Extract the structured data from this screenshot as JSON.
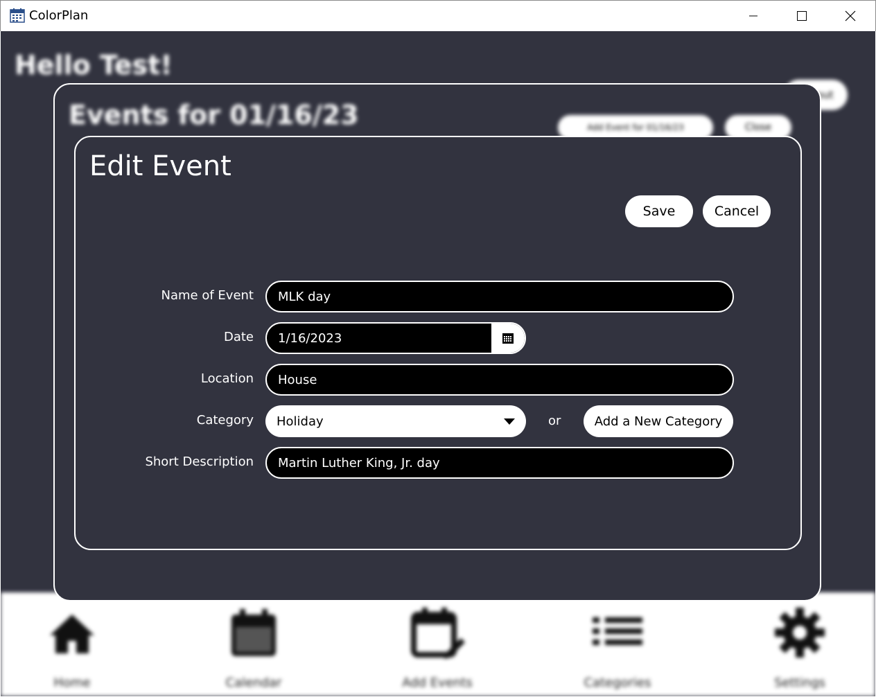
{
  "window": {
    "title": "ColorPlan",
    "icon": "calendar-app-icon"
  },
  "background": {
    "greeting": "Hello Test!",
    "top_right_button": "Logout",
    "nav": [
      {
        "label": "Home",
        "icon": "home-icon"
      },
      {
        "label": "Calendar",
        "icon": "calendar-icon"
      },
      {
        "label": "Add Events",
        "icon": "calendar-edit-icon"
      },
      {
        "label": "Categories",
        "icon": "list-icon"
      },
      {
        "label": "Settings",
        "icon": "gear-icon"
      }
    ]
  },
  "events_dialog": {
    "title": "Events for 01/16/23",
    "add_button": "Add Event for 01/16/23",
    "close_button": "Close"
  },
  "edit_dialog": {
    "title": "Edit Event",
    "save_label": "Save",
    "cancel_label": "Cancel",
    "fields": {
      "name_label": "Name of Event",
      "name_value": "MLK day",
      "date_label": "Date",
      "date_value": "1/16/2023",
      "location_label": "Location",
      "location_value": "House",
      "category_label": "Category",
      "category_value": "Holiday",
      "or_text": "or",
      "add_category_label": "Add a New Category",
      "description_label": "Short Description",
      "description_value": "Martin Luther King, Jr. day"
    }
  },
  "colors": {
    "panel_bg": "#32333f",
    "field_bg": "#000000",
    "button_bg": "#ffffff",
    "text": "#ffffff"
  }
}
